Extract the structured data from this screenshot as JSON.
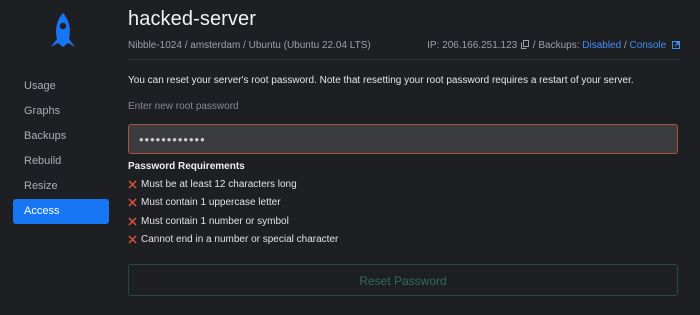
{
  "sidebar": {
    "logo_icon": "rocket-icon",
    "items": [
      {
        "label": "Usage"
      },
      {
        "label": "Graphs"
      },
      {
        "label": "Backups"
      },
      {
        "label": "Rebuild"
      },
      {
        "label": "Resize"
      },
      {
        "label": "Access",
        "active": true
      }
    ]
  },
  "header": {
    "title": "hacked-server",
    "meta_left": "Nibble-1024 / amsterdam / Ubuntu (Ubuntu 22.04 LTS)",
    "ip_text": "IP: 206.166.251.123",
    "ip_copy_icon": "copy-icon",
    "backups_prefix": " / Backups: ",
    "backups_value": "Disabled",
    "separator": " / ",
    "console_label": "Console",
    "console_icon": "external-link-icon"
  },
  "access": {
    "description": "You can reset your server's root password. Note that resetting your root password requires a restart of your server.",
    "field_label": "Enter new root password",
    "password_value": "••••••••••••",
    "requirements_title": "Password Requirements",
    "requirements": [
      {
        "text": "Must be at least 12 characters long",
        "status": "failed"
      },
      {
        "text": "Must contain 1 uppercase letter",
        "status": "failed"
      },
      {
        "text": "Must contain 1 number or symbol",
        "status": "failed"
      },
      {
        "text": "Cannot end in a number or special character",
        "status": "failed"
      }
    ],
    "reset_button": "Reset Password"
  },
  "colors": {
    "background": "#1e1f23",
    "accent": "#1676f3",
    "link": "#3d8ef5",
    "error": "#e0503c",
    "input_border": "#a9543d",
    "button_text": "#2f6d52"
  }
}
